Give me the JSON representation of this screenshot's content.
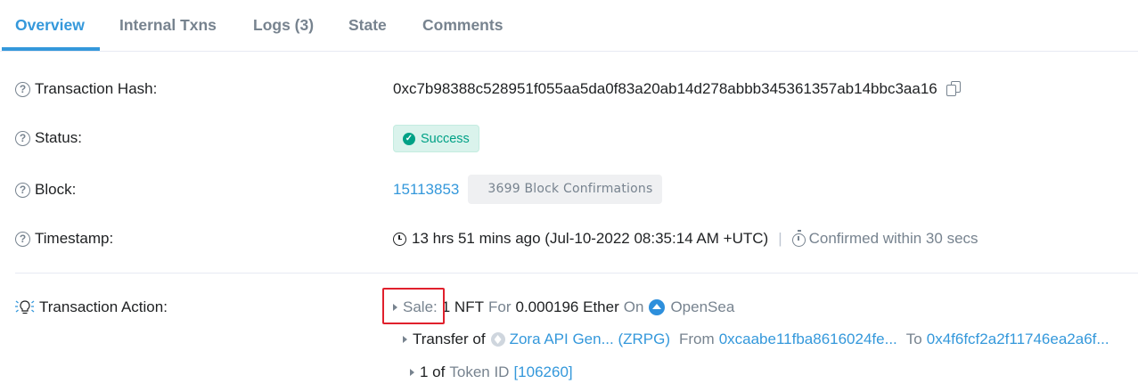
{
  "tabs": [
    {
      "label": "Overview",
      "active": true
    },
    {
      "label": "Internal Txns"
    },
    {
      "label": "Logs (3)"
    },
    {
      "label": "State"
    },
    {
      "label": "Comments"
    }
  ],
  "hash": {
    "label": "Transaction Hash:",
    "value": "0xc7b98388c528951f055aa5da0f83a20ab14d278abbb345361357ab14bbc3aa16"
  },
  "status": {
    "label": "Status:",
    "value": "Success"
  },
  "block": {
    "label": "Block:",
    "number": "15113853",
    "confirmations": "3699 Block Confirmations"
  },
  "timestamp": {
    "label": "Timestamp:",
    "value": "13 hrs 51 mins ago (Jul-10-2022 08:35:14 AM +UTC)",
    "separator": "|",
    "confirmed": "Confirmed within 30 secs"
  },
  "action": {
    "label": "Transaction Action:",
    "sale_label": "Sale:",
    "quantity": "1 NFT",
    "for_word": "For",
    "amount": "0.000196 Ether",
    "on_word": "On",
    "marketplace": "OpenSea",
    "transfer_label": "Transfer of",
    "token_name": "Zora API Gen... (ZRPG)",
    "from_word": "From",
    "from_address": "0xcaabe11fba8616024fe...",
    "to_word": "To",
    "to_address": "0x4f6fcf2a2f11746ea2a6f...",
    "count": "1 of",
    "token_id_label": "Token ID",
    "token_id": "[106260]"
  },
  "colors": {
    "link": "#3498db",
    "success": "#00a186",
    "muted": "#77838f",
    "highlight": "#e0202c"
  }
}
